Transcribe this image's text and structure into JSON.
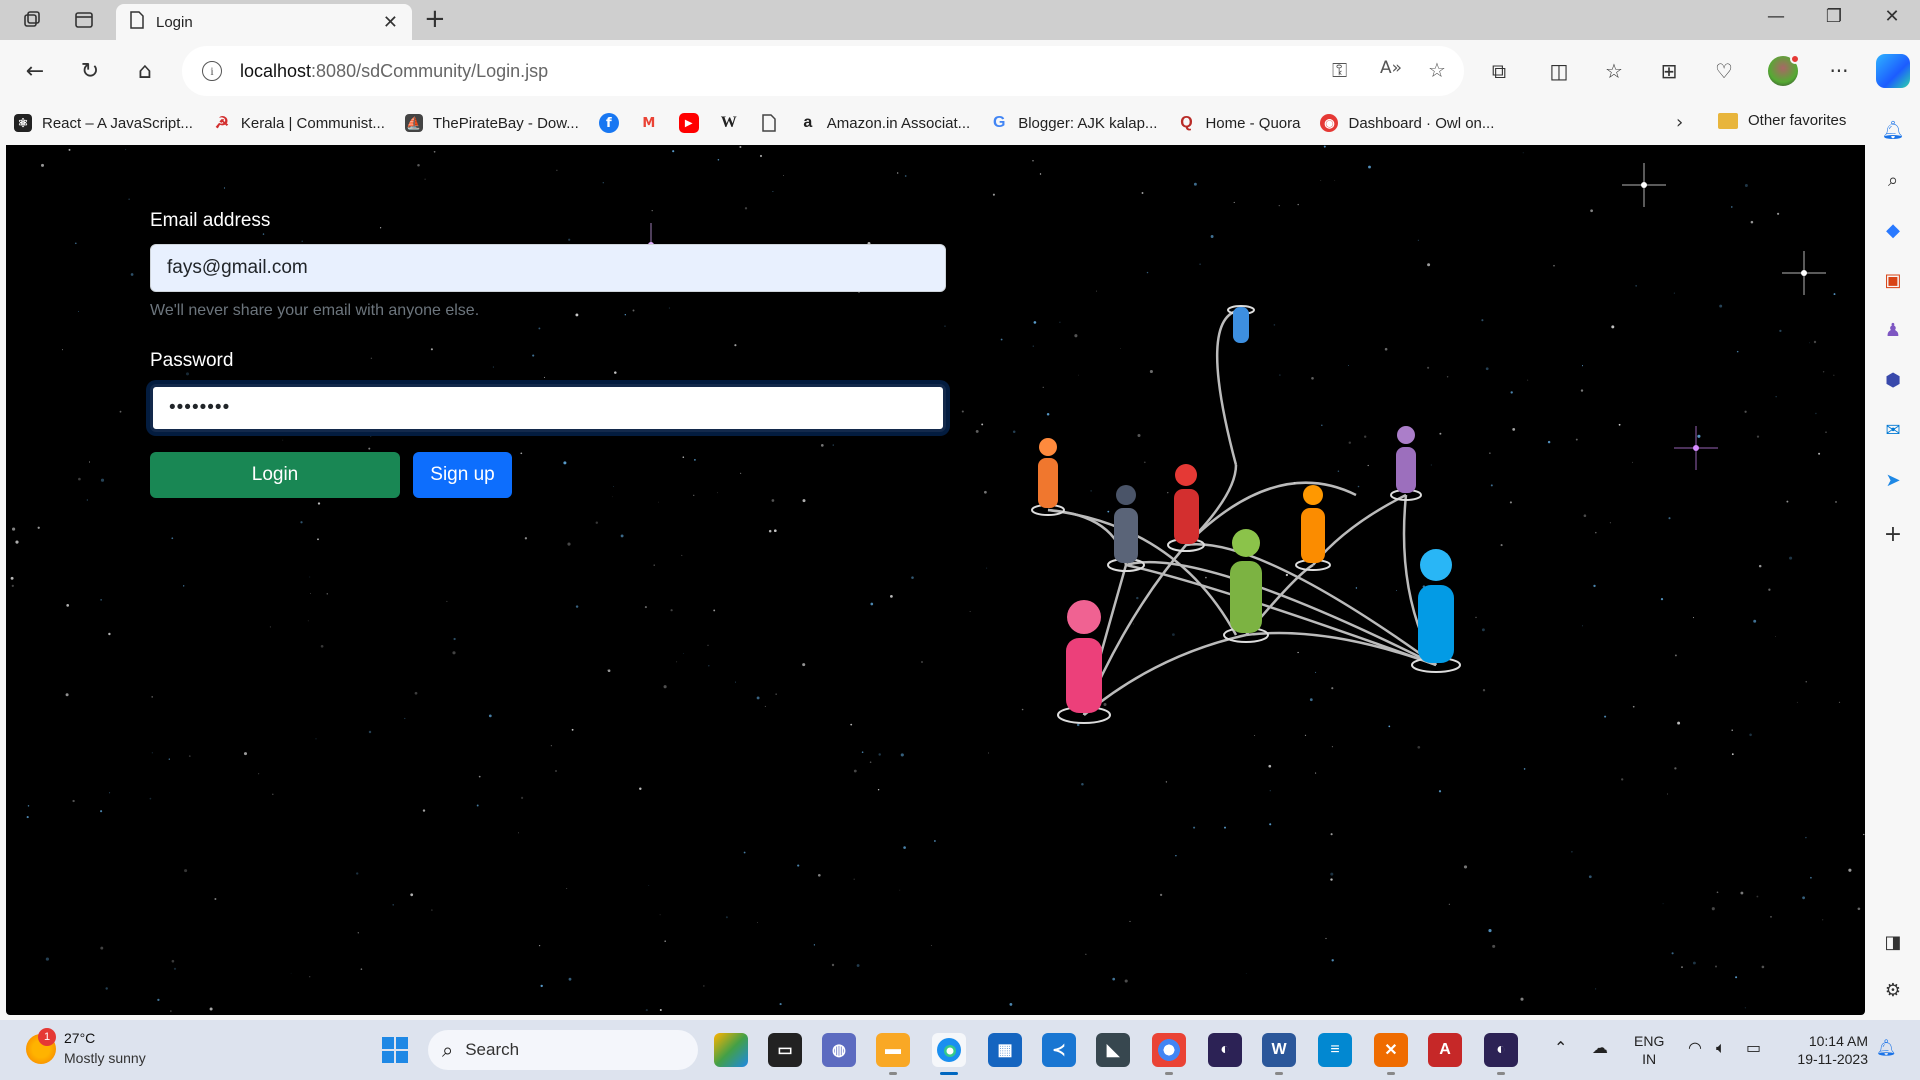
{
  "browser": {
    "tab_title": "Login",
    "url_host": "localhost",
    "url_rest": ":8080/sdCommunity/Login.jsp"
  },
  "bookmarks": [
    {
      "label": "React – A JavaScript...",
      "icon": "react-icon",
      "color": "#222"
    },
    {
      "label": "Kerala | Communist...",
      "icon": "hammer-sickle-icon",
      "color": "#d32f2f"
    },
    {
      "label": "ThePirateBay - Dow...",
      "icon": "pirate-ship-icon",
      "color": "#444"
    },
    {
      "label": "",
      "icon": "facebook-icon",
      "color": "#1877f2"
    },
    {
      "label": "",
      "icon": "gmail-icon",
      "color": "#ea4335"
    },
    {
      "label": "",
      "icon": "youtube-icon",
      "color": "#ff0000"
    },
    {
      "label": "",
      "icon": "wikipedia-icon",
      "color": "#222"
    },
    {
      "label": "",
      "icon": "page-icon",
      "color": "#555"
    },
    {
      "label": "Amazon.in Associat...",
      "icon": "amazon-icon",
      "color": "#222"
    },
    {
      "label": "Blogger: AJK kalap...",
      "icon": "google-icon",
      "color": "#4285f4"
    },
    {
      "label": "Home - Quora",
      "icon": "quora-icon",
      "color": "#b92b27"
    },
    {
      "label": "Dashboard · Owl on...",
      "icon": "owl-icon",
      "color": "#e53935"
    }
  ],
  "other_favorites": "Other favorites",
  "form": {
    "email_label": "Email address",
    "email_value": "fays@gmail.com",
    "email_help": "We'll never share your email with anyone else.",
    "password_label": "Password",
    "password_value": "••••••••",
    "login_label": "Login",
    "signup_label": "Sign up"
  },
  "taskbar": {
    "weather_badge": "1",
    "temperature": "27°C",
    "weather_desc": "Mostly sunny",
    "search_label": "Search",
    "lang_line1": "ENG",
    "lang_line2": "IN",
    "time": "10:14 AM",
    "date": "19-11-2023"
  },
  "colors": {
    "login_button": "#198754",
    "signup_button": "#0d6efd",
    "page_background": "#000000"
  }
}
